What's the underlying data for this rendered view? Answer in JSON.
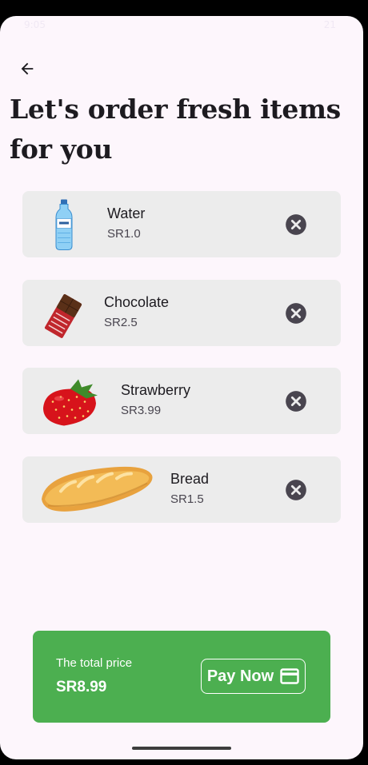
{
  "status_bar": {
    "time": "9:05",
    "battery": "21"
  },
  "header": {
    "title": "Let's order fresh items for you"
  },
  "items": [
    {
      "name": "Water",
      "price": "SR1.0",
      "image_icon": "water-bottle-image"
    },
    {
      "name": "Chocolate",
      "price": "SR2.5",
      "image_icon": "chocolate-bar-image"
    },
    {
      "name": "Strawberry",
      "price": "SR3.99",
      "image_icon": "strawberry-image"
    },
    {
      "name": "Bread",
      "price": "SR1.5",
      "image_icon": "bread-loaf-image"
    }
  ],
  "footer": {
    "total_label": "The total price",
    "total_value": "SR8.99",
    "pay_label": "Pay Now"
  },
  "colors": {
    "background": "#fdf6fc",
    "card": "#ececec",
    "accent": "#4caf50",
    "text": "#1d1b20"
  }
}
